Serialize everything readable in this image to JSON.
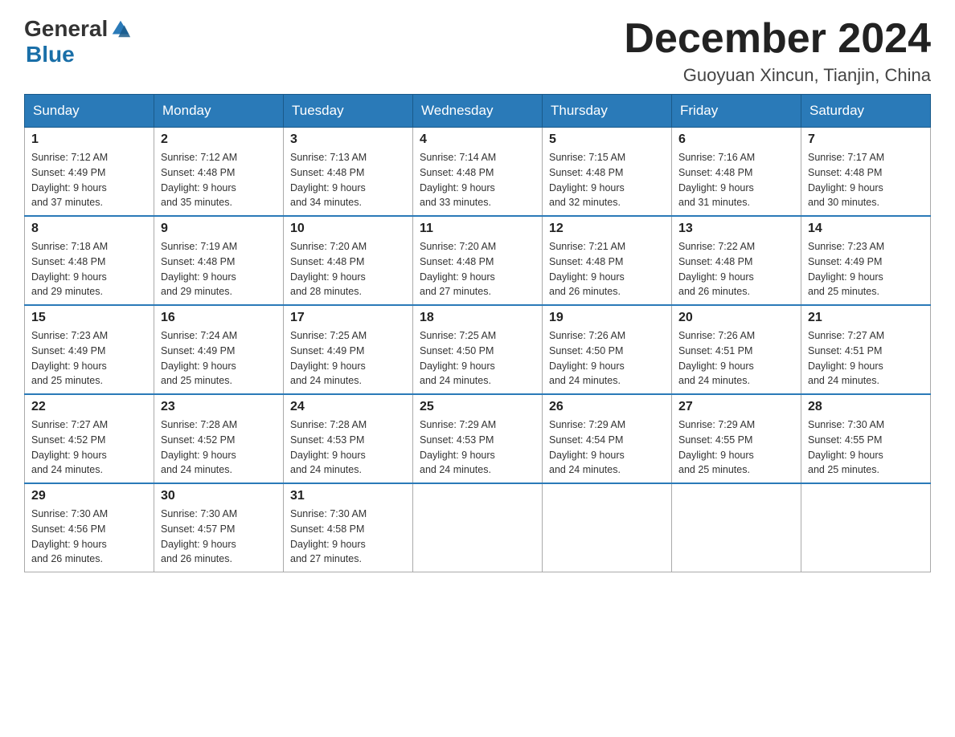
{
  "header": {
    "logo_general": "General",
    "logo_blue": "Blue",
    "month_title": "December 2024",
    "location": "Guoyuan Xincun, Tianjin, China"
  },
  "weekdays": [
    "Sunday",
    "Monday",
    "Tuesday",
    "Wednesday",
    "Thursday",
    "Friday",
    "Saturday"
  ],
  "weeks": [
    [
      {
        "day": "1",
        "sunrise": "7:12 AM",
        "sunset": "4:49 PM",
        "daylight": "9 hours and 37 minutes."
      },
      {
        "day": "2",
        "sunrise": "7:12 AM",
        "sunset": "4:48 PM",
        "daylight": "9 hours and 35 minutes."
      },
      {
        "day": "3",
        "sunrise": "7:13 AM",
        "sunset": "4:48 PM",
        "daylight": "9 hours and 34 minutes."
      },
      {
        "day": "4",
        "sunrise": "7:14 AM",
        "sunset": "4:48 PM",
        "daylight": "9 hours and 33 minutes."
      },
      {
        "day": "5",
        "sunrise": "7:15 AM",
        "sunset": "4:48 PM",
        "daylight": "9 hours and 32 minutes."
      },
      {
        "day": "6",
        "sunrise": "7:16 AM",
        "sunset": "4:48 PM",
        "daylight": "9 hours and 31 minutes."
      },
      {
        "day": "7",
        "sunrise": "7:17 AM",
        "sunset": "4:48 PM",
        "daylight": "9 hours and 30 minutes."
      }
    ],
    [
      {
        "day": "8",
        "sunrise": "7:18 AM",
        "sunset": "4:48 PM",
        "daylight": "9 hours and 29 minutes."
      },
      {
        "day": "9",
        "sunrise": "7:19 AM",
        "sunset": "4:48 PM",
        "daylight": "9 hours and 29 minutes."
      },
      {
        "day": "10",
        "sunrise": "7:20 AM",
        "sunset": "4:48 PM",
        "daylight": "9 hours and 28 minutes."
      },
      {
        "day": "11",
        "sunrise": "7:20 AM",
        "sunset": "4:48 PM",
        "daylight": "9 hours and 27 minutes."
      },
      {
        "day": "12",
        "sunrise": "7:21 AM",
        "sunset": "4:48 PM",
        "daylight": "9 hours and 26 minutes."
      },
      {
        "day": "13",
        "sunrise": "7:22 AM",
        "sunset": "4:48 PM",
        "daylight": "9 hours and 26 minutes."
      },
      {
        "day": "14",
        "sunrise": "7:23 AM",
        "sunset": "4:49 PM",
        "daylight": "9 hours and 25 minutes."
      }
    ],
    [
      {
        "day": "15",
        "sunrise": "7:23 AM",
        "sunset": "4:49 PM",
        "daylight": "9 hours and 25 minutes."
      },
      {
        "day": "16",
        "sunrise": "7:24 AM",
        "sunset": "4:49 PM",
        "daylight": "9 hours and 25 minutes."
      },
      {
        "day": "17",
        "sunrise": "7:25 AM",
        "sunset": "4:49 PM",
        "daylight": "9 hours and 24 minutes."
      },
      {
        "day": "18",
        "sunrise": "7:25 AM",
        "sunset": "4:50 PM",
        "daylight": "9 hours and 24 minutes."
      },
      {
        "day": "19",
        "sunrise": "7:26 AM",
        "sunset": "4:50 PM",
        "daylight": "9 hours and 24 minutes."
      },
      {
        "day": "20",
        "sunrise": "7:26 AM",
        "sunset": "4:51 PM",
        "daylight": "9 hours and 24 minutes."
      },
      {
        "day": "21",
        "sunrise": "7:27 AM",
        "sunset": "4:51 PM",
        "daylight": "9 hours and 24 minutes."
      }
    ],
    [
      {
        "day": "22",
        "sunrise": "7:27 AM",
        "sunset": "4:52 PM",
        "daylight": "9 hours and 24 minutes."
      },
      {
        "day": "23",
        "sunrise": "7:28 AM",
        "sunset": "4:52 PM",
        "daylight": "9 hours and 24 minutes."
      },
      {
        "day": "24",
        "sunrise": "7:28 AM",
        "sunset": "4:53 PM",
        "daylight": "9 hours and 24 minutes."
      },
      {
        "day": "25",
        "sunrise": "7:29 AM",
        "sunset": "4:53 PM",
        "daylight": "9 hours and 24 minutes."
      },
      {
        "day": "26",
        "sunrise": "7:29 AM",
        "sunset": "4:54 PM",
        "daylight": "9 hours and 24 minutes."
      },
      {
        "day": "27",
        "sunrise": "7:29 AM",
        "sunset": "4:55 PM",
        "daylight": "9 hours and 25 minutes."
      },
      {
        "day": "28",
        "sunrise": "7:30 AM",
        "sunset": "4:55 PM",
        "daylight": "9 hours and 25 minutes."
      }
    ],
    [
      {
        "day": "29",
        "sunrise": "7:30 AM",
        "sunset": "4:56 PM",
        "daylight": "9 hours and 26 minutes."
      },
      {
        "day": "30",
        "sunrise": "7:30 AM",
        "sunset": "4:57 PM",
        "daylight": "9 hours and 26 minutes."
      },
      {
        "day": "31",
        "sunrise": "7:30 AM",
        "sunset": "4:58 PM",
        "daylight": "9 hours and 27 minutes."
      },
      null,
      null,
      null,
      null
    ]
  ],
  "labels": {
    "sunrise": "Sunrise:",
    "sunset": "Sunset:",
    "daylight": "Daylight:"
  }
}
